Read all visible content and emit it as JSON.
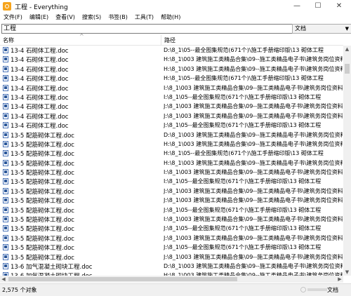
{
  "window": {
    "title": "工程 - Everything",
    "minimize_glyph": "—",
    "maximize_glyph": "☐",
    "close_glyph": "✕"
  },
  "menu": [
    "文件(F)",
    "编辑(E)",
    "查看(V)",
    "搜索(S)",
    "书签(B)",
    "工具(T)",
    "帮助(H)"
  ],
  "search": {
    "value": "工程",
    "filter": "文档"
  },
  "columns": {
    "name": "名称",
    "path": "路径",
    "sort_glyph": "^"
  },
  "rows": [
    {
      "name": "13-4 石砌体工程.doc",
      "path": "D:\\8_1\\05--最全图集规范(671个)\\施工手册缩印版\\13 砌体工程"
    },
    {
      "name": "13-4 石砌体工程.doc",
      "path": "H:\\8_1\\003 建筑施工类精品合集\\09--施工类精品电子书\\建筑务岗位资料大"
    },
    {
      "name": "13-4 石砌体工程.doc",
      "path": "H:\\8_1\\003 建筑施工类精品合集\\09--施工类精品电子书\\建筑务岗位资料大"
    },
    {
      "name": "13-4 石砌体工程.doc",
      "path": "H:\\8_1\\05--最全图集规范(671个)\\施工手册缩印版\\13 砌体工程"
    },
    {
      "name": "13-4 石砌体工程.doc",
      "path": "I:\\8_1\\003 建筑施工类精品合集\\09--施工类精品电子书\\建筑务岗位资料大"
    },
    {
      "name": "13-4 石砌体工程.doc",
      "path": "I:\\8_1\\05--最全图集规范(671个)\\施工手册缩印版\\13 砌体工程"
    },
    {
      "name": "13-4 石砌体工程.doc",
      "path": "J:\\8_1\\003 建筑施工类精品合集\\09--施工类精品电子书\\建筑务岗位资料大"
    },
    {
      "name": "13-4 石砌体工程.doc",
      "path": "J:\\8_1\\003 建筑施工类精品合集\\09--施工类精品电子书\\建筑务岗位资料大"
    },
    {
      "name": "13-4 石砌体工程.doc",
      "path": "J:\\8_1\\05--最全图集规范(671个)\\施工手册缩印版\\13 砌体工程"
    },
    {
      "name": "13-5 配筋砌体工程.doc",
      "path": "D:\\8_1\\003 建筑施工类精品合集\\09--施工类精品电子书\\建筑务岗位资料大"
    },
    {
      "name": "13-5 配筋砌体工程.doc",
      "path": "H:\\8_1\\003 建筑施工类精品合集\\09--施工类精品电子书\\建筑务岗位资料大"
    },
    {
      "name": "13-5 配筋砌体工程.doc",
      "path": "H:\\8_1\\05--最全图集规范(671个)\\施工手册缩印版\\13 砌体工程"
    },
    {
      "name": "13-5 配筋砌体工程.doc",
      "path": "H:\\8_1\\003 建筑施工类精品合集\\09--施工类精品电子书\\建筑务岗位资料大"
    },
    {
      "name": "13-5 配筋砌体工程.doc",
      "path": "I:\\8_1\\003 建筑施工类精品合集\\09--施工类精品电子书\\建筑务岗位资料大"
    },
    {
      "name": "13-5 配筋砌体工程.doc",
      "path": "I:\\8_1\\05--最全图集规范(671个)\\施工手册缩印版\\13 砌体工程"
    },
    {
      "name": "13-5 配筋砌体工程.doc",
      "path": "J:\\8_1\\003 建筑施工类精品合集\\09--施工类精品电子书\\建筑务岗位资料大"
    },
    {
      "name": "13-5 配筋砌体工程.doc",
      "path": "J:\\8_1\\003 建筑施工类精品合集\\09--施工类精品电子书\\建筑务岗位资料大"
    },
    {
      "name": "13-5 配筋砌体工程.doc",
      "path": "J:\\8_1\\05--最全图集规范(671个)\\施工手册缩印版\\13 砌体工程"
    },
    {
      "name": "13-5 配筋砌体工程.doc",
      "path": "I:\\8_1\\003 建筑施工类精品合集\\09--施工类精品电子书\\建筑务岗位资料大"
    },
    {
      "name": "13-5 配筋砌体工程.doc",
      "path": "J:\\8_1\\05--最全图集规范(671个)\\施工手册缩印版\\13 砌体工程"
    },
    {
      "name": "13-5 配筋砌体工程.doc",
      "path": "J:\\8_1\\003 建筑施工类精品合集\\09--施工类精品电子书\\建筑务岗位资料大"
    },
    {
      "name": "13-5 配筋砌体工程.doc",
      "path": "J:\\8_1\\05--最全图集规范(671个)\\施工手册缩印版\\13 砌体工程"
    },
    {
      "name": "13-5 配筋砌体工程.doc",
      "path": "J:\\8_1\\003 建筑施工类精品合集\\09--施工类精品电子书\\建筑务岗位资料大"
    },
    {
      "name": "13-6 加气混凝土砌块工程.doc",
      "path": "D:\\8_1\\003 建筑施工类精品合集\\09--施工类精品电子书\\建筑务岗位资料大"
    },
    {
      "name": "13-6 加气混凝土砌块工程.doc",
      "path": "H:\\8_1\\003 建筑施工类精品合集\\09--施工类精品电子书\\建筑务岗位资料大"
    },
    {
      "name": "13-6 加气混凝土砌块工程.doc",
      "path": "J:\\8_1\\05--最全图集规范(671个)\\施工手册缩印版\\13 砌体工程"
    }
  ],
  "status": {
    "count": "2,575 个对象",
    "filter": "文档"
  }
}
